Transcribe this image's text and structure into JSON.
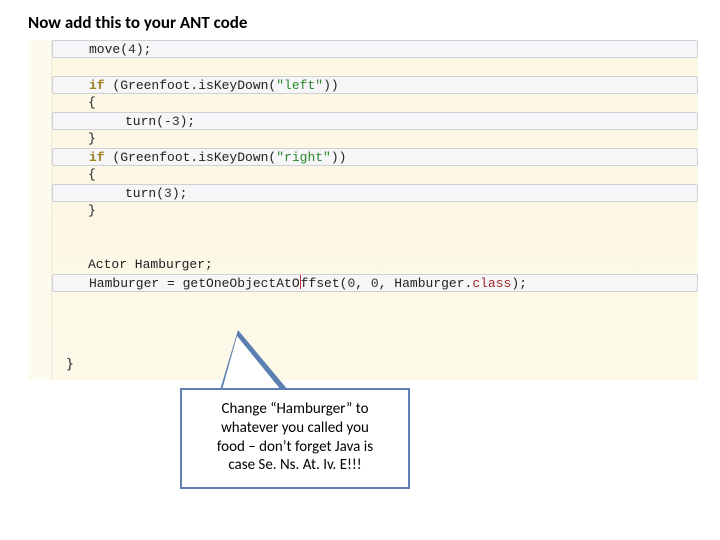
{
  "heading": "Now add this to your ANT code",
  "code": {
    "l1a": "move",
    "l1b": "(",
    "l1c": "4",
    "l1d": ");",
    "l2a": "if",
    "l2b": " (Greenfoot.isKeyDown(",
    "l2c": "\"left\"",
    "l2d": "))",
    "l3": "{",
    "l4a": "turn(",
    "l4b": "-3",
    "l4c": ");",
    "l5": "}",
    "l6a": "if",
    "l6b": " (Greenfoot.isKeyDown(",
    "l6c": "\"right\"",
    "l6d": "))",
    "l7": "{",
    "l8a": "turn(",
    "l8b": "3",
    "l8c": ");",
    "l9": "}",
    "l10": "Actor Hamburger;",
    "l11a": "Hamburger = getOneObjectAtO",
    "l11b": "ffset(",
    "l11c": "0",
    "l11d": ", ",
    "l11e": "0",
    "l11f": ", Hamburger.",
    "l11g": "class",
    "l11h": ");",
    "end": "}"
  },
  "callout": {
    "line1": "Change “Hamburger” to",
    "line2": "whatever you called you",
    "line3": "food – don’t forget Java is",
    "line4": "case Se. Ns. At. Iv. E!!!"
  }
}
